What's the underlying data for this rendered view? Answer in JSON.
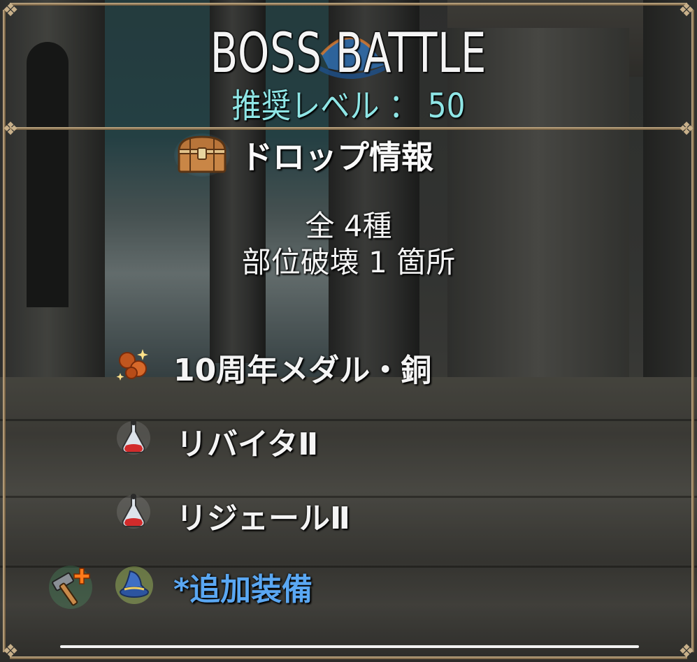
{
  "header": {
    "title": "BOSS BATTLE",
    "recommended_level": "推奨レベル ： 50"
  },
  "drop_info": {
    "heading": "ドロップ情報",
    "icon": "treasure-chest-icon",
    "total": "全 4種",
    "part_break": "部位破壊 1 箇所"
  },
  "items": [
    {
      "label": "10周年メダル・銅",
      "icon": "bronze-medal-icon"
    },
    {
      "label": "リバイタⅡ",
      "icon": "red-potion-icon"
    },
    {
      "label": "リジェールⅡ",
      "icon": "red-potion-icon"
    },
    {
      "label": "*追加装備",
      "icon": "wizard-hat-icon",
      "extra_icon": "hammer-plus-icon"
    }
  ],
  "colors": {
    "title": "#f4f4f4",
    "level": "#8fe6e6",
    "link": "#5aa7f2",
    "frame": "#c8b08a"
  }
}
